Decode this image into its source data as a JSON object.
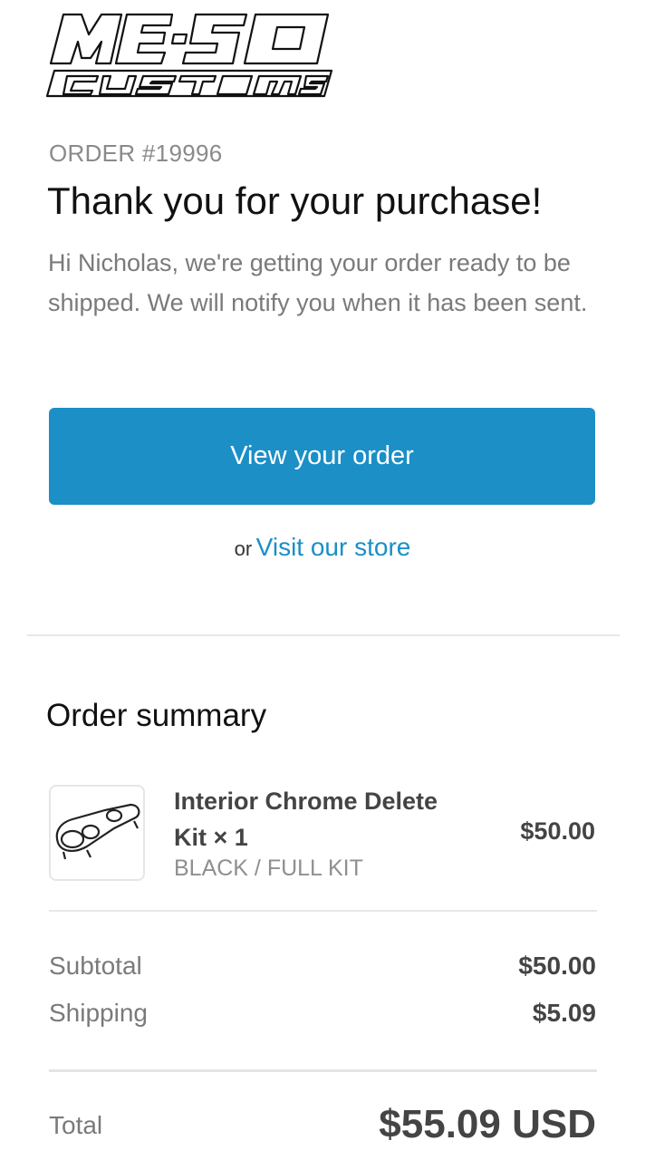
{
  "brand": {
    "logo_line1": "ME-SO",
    "logo_line2": "CUSTOMS"
  },
  "order": {
    "number": "ORDER #19996",
    "title": "Thank you for your purchase!",
    "message": "Hi Nicholas, we're getting your order ready to be shipped. We will notify you when it has been sent."
  },
  "actions": {
    "view_order": "View your order",
    "or": "or",
    "visit_store": "Visit our store"
  },
  "summary": {
    "heading": "Order summary",
    "items": [
      {
        "name": "Interior Chrome Delete Kit × 1",
        "variant": "BLACK / FULL KIT",
        "price": "$50.00",
        "image": "chrome-delete-kit-thumbnail"
      }
    ],
    "subtotal_label": "Subtotal",
    "subtotal_value": "$50.00",
    "shipping_label": "Shipping",
    "shipping_value": "$5.09",
    "total_label": "Total",
    "total_value": "$55.09 USD"
  },
  "colors": {
    "accent": "#1b8fc6",
    "heading": "#111111",
    "muted": "#7a7a7a"
  }
}
